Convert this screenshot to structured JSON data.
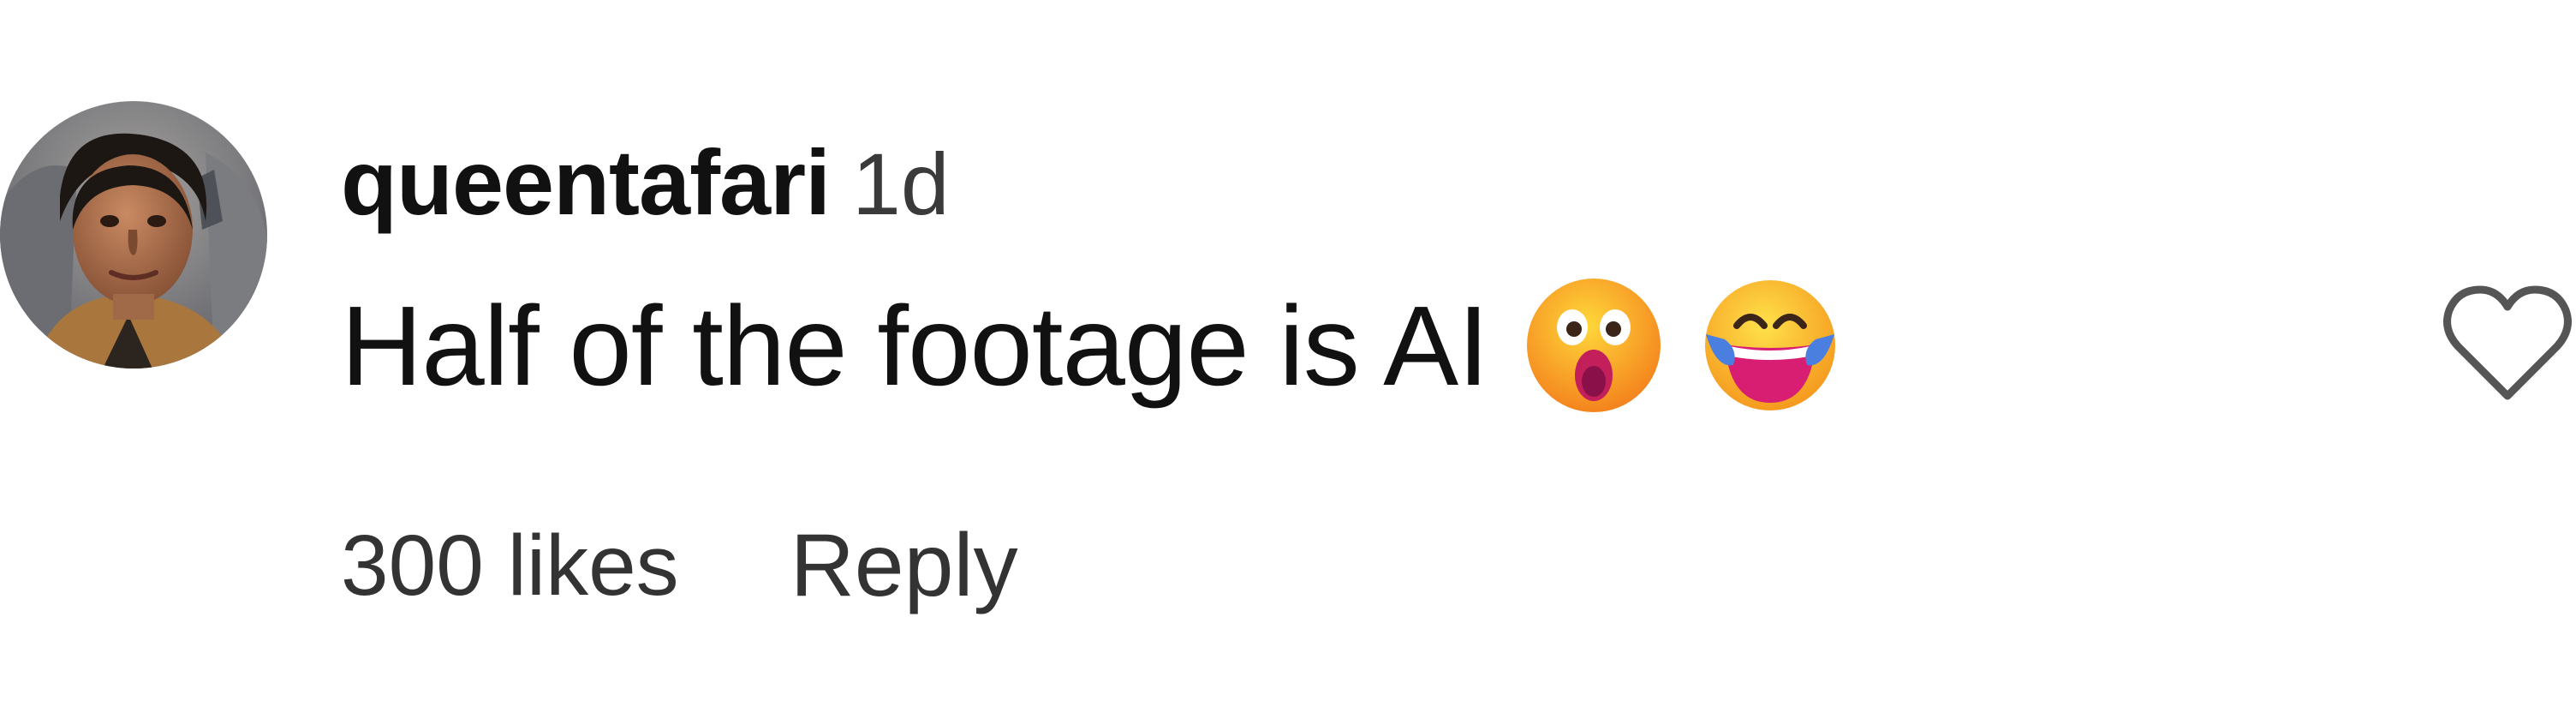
{
  "comment": {
    "username": "queentafari",
    "timestamp": "1d",
    "text": "Half of the footage is AI",
    "emojis": [
      "astonished-face-emoji",
      "face-with-tears-of-joy-emoji"
    ],
    "likes_label": "300 likes",
    "reply_label": "Reply",
    "avatar_icon": "user-avatar",
    "like_icon": "heart-outline-icon"
  },
  "colors": {
    "text": "#111111",
    "secondary_text": "#333333",
    "heart_stroke": "#555555",
    "background": "#ffffff"
  }
}
